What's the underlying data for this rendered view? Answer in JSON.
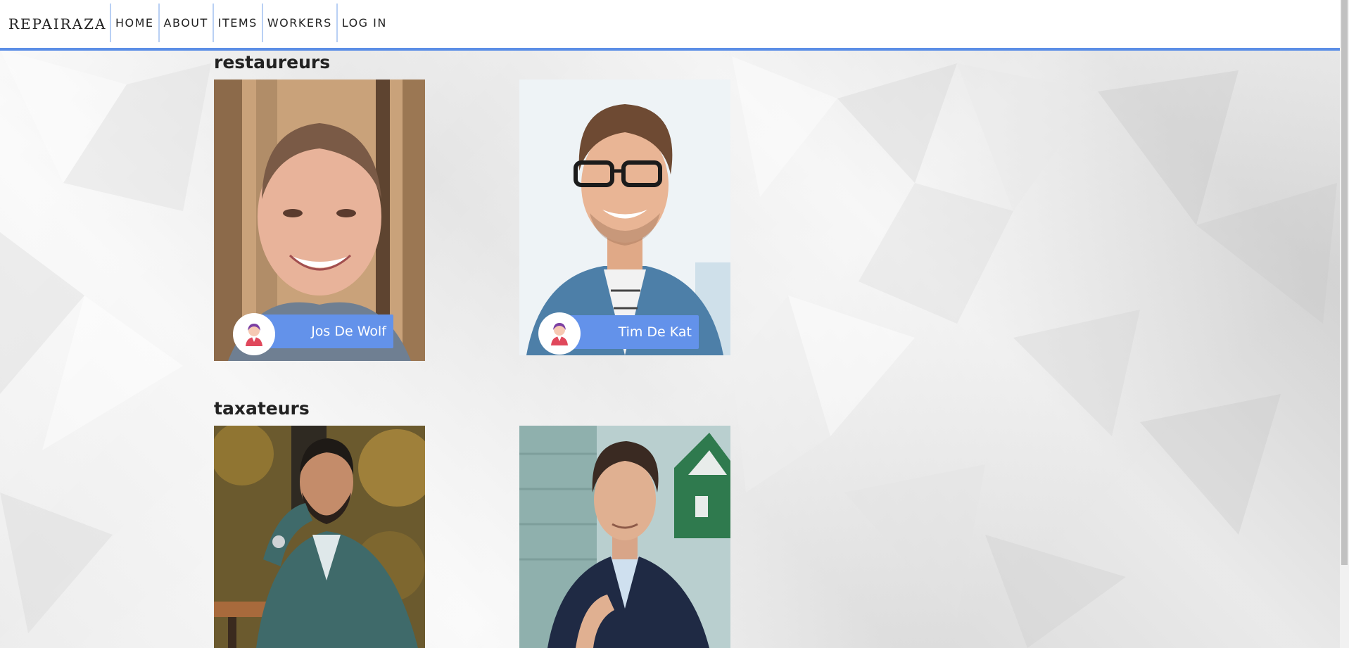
{
  "brand": "REPAIRAZA",
  "nav": {
    "home": "HOME",
    "about": "ABOUT",
    "items": "ITEMS",
    "workers": "WORKERS",
    "login": "LOG IN"
  },
  "colors": {
    "accent": "#5b8ee6",
    "badge": "#6392ea",
    "nav_divider": "#b9d0f4"
  },
  "sections": [
    {
      "title": "restaureurs",
      "workers": [
        {
          "name": "Jos De Wolf",
          "photo": "bald-smiling-man-photo",
          "avatar_icon": "worker-avatar-icon"
        },
        {
          "name": "Tim De Kat",
          "photo": "man-with-glasses-denim-shirt-photo",
          "avatar_icon": "worker-avatar-icon"
        }
      ]
    },
    {
      "title": "taxateurs",
      "workers": [
        {
          "name": "",
          "photo": "bearded-man-suit-cafe-photo"
        },
        {
          "name": "",
          "photo": "man-navy-blazer-street-photo"
        }
      ]
    }
  ]
}
